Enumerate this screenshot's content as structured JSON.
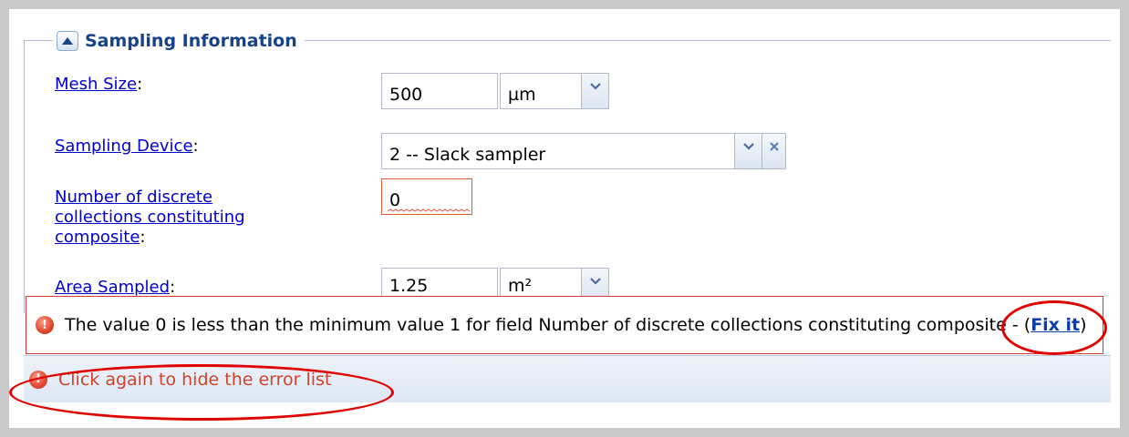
{
  "section": {
    "title": "Sampling Information"
  },
  "fields": {
    "mesh_size": {
      "label": "Mesh Size",
      "colon": ":",
      "value": "500",
      "unit": "µm"
    },
    "sampling_device": {
      "label": "Sampling Device",
      "colon": ":",
      "value": "2 -- Slack sampler"
    },
    "discrete_collections": {
      "label_lines": [
        "Number of discrete",
        "collections constituting",
        "composite"
      ],
      "colon": ":",
      "value": "0"
    },
    "area_sampled": {
      "label": "Area Sampled",
      "colon": ":",
      "value": "1.25",
      "unit": "m²"
    }
  },
  "error": {
    "message": "The value 0 is less than the minimum value 1 for field Number of discrete collections constituting composite",
    "separator": " - (",
    "fix_link": "Fix it",
    "close_paren": ")"
  },
  "status_bar": {
    "text": "Click again to hide the error list"
  },
  "colors": {
    "error_red": "#d0432b",
    "link_blue": "#0000cc",
    "annotation_red": "#e00000"
  }
}
